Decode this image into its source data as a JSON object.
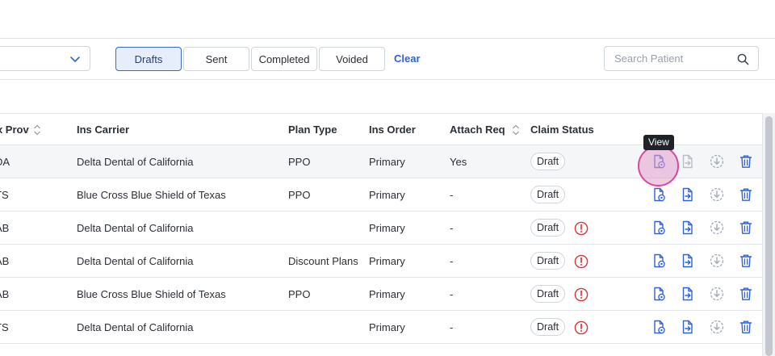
{
  "filters": {
    "segments": [
      {
        "label": "Drafts",
        "active": true
      },
      {
        "label": "Sent",
        "active": false
      },
      {
        "label": "Completed",
        "active": false
      },
      {
        "label": "Voided",
        "active": false
      }
    ],
    "clear_label": "Clear",
    "search_placeholder": "Search Patient"
  },
  "table": {
    "columns": {
      "tx_prov": "Tx Prov",
      "ins_carrier": "Ins Carrier",
      "plan_type": "Plan Type",
      "ins_order": "Ins Order",
      "attach_req": "Attach Req",
      "claim_status": "Claim Status"
    },
    "rows": [
      {
        "tx_prov": "DA",
        "ins_carrier": "Delta Dental of California",
        "plan_type": "PPO",
        "ins_order": "Primary",
        "attach_req": "Yes",
        "claim_status": "Draft",
        "warning": false
      },
      {
        "tx_prov": "TS",
        "ins_carrier": "Blue Cross Blue Shield of Texas",
        "plan_type": "PPO",
        "ins_order": "Primary",
        "attach_req": "-",
        "claim_status": "Draft",
        "warning": false
      },
      {
        "tx_prov": "AB",
        "ins_carrier": "Delta Dental of California",
        "plan_type": "",
        "ins_order": "Primary",
        "attach_req": "-",
        "claim_status": "Draft",
        "warning": true
      },
      {
        "tx_prov": "AB",
        "ins_carrier": "Delta Dental of California",
        "plan_type": "Discount Plans",
        "ins_order": "Primary",
        "attach_req": "-",
        "claim_status": "Draft",
        "warning": true
      },
      {
        "tx_prov": "AB",
        "ins_carrier": "Blue Cross Blue Shield of Texas",
        "plan_type": "PPO",
        "ins_order": "Primary",
        "attach_req": "-",
        "claim_status": "Draft",
        "warning": true
      },
      {
        "tx_prov": "TS",
        "ins_carrier": "Delta Dental of California",
        "plan_type": "",
        "ins_order": "Primary",
        "attach_req": "-",
        "claim_status": "Draft",
        "warning": true
      }
    ]
  },
  "tooltip": {
    "text": "View"
  },
  "colors": {
    "accent": "#2f62d8",
    "warning": "#d93636",
    "hover": "#d9489a"
  },
  "icons": {
    "view": "document-view-icon",
    "send": "document-send-icon",
    "download": "download-icon",
    "delete": "trash-icon",
    "warning": "alert-circle-icon"
  }
}
